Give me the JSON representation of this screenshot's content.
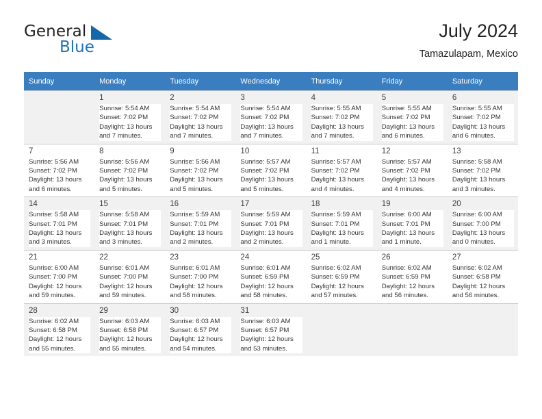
{
  "brand": {
    "name_part1": "General",
    "name_part2": "Blue",
    "triangle_icon": "blue-triangle-logo-icon",
    "accent_color": "#1566ab"
  },
  "header": {
    "title": "July 2024",
    "subtitle": "Tamazulapam, Mexico"
  },
  "theme": {
    "header_row_bg": "#3a7ebf",
    "header_row_text": "#ffffff",
    "alt_row_bg": "#f1f1f1",
    "cell_bg": "#ffffff",
    "grid_line": "#c8c8c8"
  },
  "calendar": {
    "weekday_headers": [
      "Sunday",
      "Monday",
      "Tuesday",
      "Wednesday",
      "Thursday",
      "Friday",
      "Saturday"
    ],
    "weeks": [
      {
        "band": "grey",
        "days": [
          {
            "num": "",
            "sunrise": "",
            "sunset": "",
            "daylight_hours": "",
            "daylight_minutes": ""
          },
          {
            "num": "1",
            "sunrise": "Sunrise: 5:54 AM",
            "sunset": "Sunset: 7:02 PM",
            "daylight_hours": "Daylight: 13 hours",
            "daylight_minutes": "and 7 minutes."
          },
          {
            "num": "2",
            "sunrise": "Sunrise: 5:54 AM",
            "sunset": "Sunset: 7:02 PM",
            "daylight_hours": "Daylight: 13 hours",
            "daylight_minutes": "and 7 minutes."
          },
          {
            "num": "3",
            "sunrise": "Sunrise: 5:54 AM",
            "sunset": "Sunset: 7:02 PM",
            "daylight_hours": "Daylight: 13 hours",
            "daylight_minutes": "and 7 minutes."
          },
          {
            "num": "4",
            "sunrise": "Sunrise: 5:55 AM",
            "sunset": "Sunset: 7:02 PM",
            "daylight_hours": "Daylight: 13 hours",
            "daylight_minutes": "and 7 minutes."
          },
          {
            "num": "5",
            "sunrise": "Sunrise: 5:55 AM",
            "sunset": "Sunset: 7:02 PM",
            "daylight_hours": "Daylight: 13 hours",
            "daylight_minutes": "and 6 minutes."
          },
          {
            "num": "6",
            "sunrise": "Sunrise: 5:55 AM",
            "sunset": "Sunset: 7:02 PM",
            "daylight_hours": "Daylight: 13 hours",
            "daylight_minutes": "and 6 minutes."
          }
        ]
      },
      {
        "band": "white",
        "days": [
          {
            "num": "7",
            "sunrise": "Sunrise: 5:56 AM",
            "sunset": "Sunset: 7:02 PM",
            "daylight_hours": "Daylight: 13 hours",
            "daylight_minutes": "and 6 minutes."
          },
          {
            "num": "8",
            "sunrise": "Sunrise: 5:56 AM",
            "sunset": "Sunset: 7:02 PM",
            "daylight_hours": "Daylight: 13 hours",
            "daylight_minutes": "and 5 minutes."
          },
          {
            "num": "9",
            "sunrise": "Sunrise: 5:56 AM",
            "sunset": "Sunset: 7:02 PM",
            "daylight_hours": "Daylight: 13 hours",
            "daylight_minutes": "and 5 minutes."
          },
          {
            "num": "10",
            "sunrise": "Sunrise: 5:57 AM",
            "sunset": "Sunset: 7:02 PM",
            "daylight_hours": "Daylight: 13 hours",
            "daylight_minutes": "and 5 minutes."
          },
          {
            "num": "11",
            "sunrise": "Sunrise: 5:57 AM",
            "sunset": "Sunset: 7:02 PM",
            "daylight_hours": "Daylight: 13 hours",
            "daylight_minutes": "and 4 minutes."
          },
          {
            "num": "12",
            "sunrise": "Sunrise: 5:57 AM",
            "sunset": "Sunset: 7:02 PM",
            "daylight_hours": "Daylight: 13 hours",
            "daylight_minutes": "and 4 minutes."
          },
          {
            "num": "13",
            "sunrise": "Sunrise: 5:58 AM",
            "sunset": "Sunset: 7:02 PM",
            "daylight_hours": "Daylight: 13 hours",
            "daylight_minutes": "and 3 minutes."
          }
        ]
      },
      {
        "band": "grey",
        "days": [
          {
            "num": "14",
            "sunrise": "Sunrise: 5:58 AM",
            "sunset": "Sunset: 7:01 PM",
            "daylight_hours": "Daylight: 13 hours",
            "daylight_minutes": "and 3 minutes."
          },
          {
            "num": "15",
            "sunrise": "Sunrise: 5:58 AM",
            "sunset": "Sunset: 7:01 PM",
            "daylight_hours": "Daylight: 13 hours",
            "daylight_minutes": "and 3 minutes."
          },
          {
            "num": "16",
            "sunrise": "Sunrise: 5:59 AM",
            "sunset": "Sunset: 7:01 PM",
            "daylight_hours": "Daylight: 13 hours",
            "daylight_minutes": "and 2 minutes."
          },
          {
            "num": "17",
            "sunrise": "Sunrise: 5:59 AM",
            "sunset": "Sunset: 7:01 PM",
            "daylight_hours": "Daylight: 13 hours",
            "daylight_minutes": "and 2 minutes."
          },
          {
            "num": "18",
            "sunrise": "Sunrise: 5:59 AM",
            "sunset": "Sunset: 7:01 PM",
            "daylight_hours": "Daylight: 13 hours",
            "daylight_minutes": "and 1 minute."
          },
          {
            "num": "19",
            "sunrise": "Sunrise: 6:00 AM",
            "sunset": "Sunset: 7:01 PM",
            "daylight_hours": "Daylight: 13 hours",
            "daylight_minutes": "and 1 minute."
          },
          {
            "num": "20",
            "sunrise": "Sunrise: 6:00 AM",
            "sunset": "Sunset: 7:00 PM",
            "daylight_hours": "Daylight: 13 hours",
            "daylight_minutes": "and 0 minutes."
          }
        ]
      },
      {
        "band": "white",
        "days": [
          {
            "num": "21",
            "sunrise": "Sunrise: 6:00 AM",
            "sunset": "Sunset: 7:00 PM",
            "daylight_hours": "Daylight: 12 hours",
            "daylight_minutes": "and 59 minutes."
          },
          {
            "num": "22",
            "sunrise": "Sunrise: 6:01 AM",
            "sunset": "Sunset: 7:00 PM",
            "daylight_hours": "Daylight: 12 hours",
            "daylight_minutes": "and 59 minutes."
          },
          {
            "num": "23",
            "sunrise": "Sunrise: 6:01 AM",
            "sunset": "Sunset: 7:00 PM",
            "daylight_hours": "Daylight: 12 hours",
            "daylight_minutes": "and 58 minutes."
          },
          {
            "num": "24",
            "sunrise": "Sunrise: 6:01 AM",
            "sunset": "Sunset: 6:59 PM",
            "daylight_hours": "Daylight: 12 hours",
            "daylight_minutes": "and 58 minutes."
          },
          {
            "num": "25",
            "sunrise": "Sunrise: 6:02 AM",
            "sunset": "Sunset: 6:59 PM",
            "daylight_hours": "Daylight: 12 hours",
            "daylight_minutes": "and 57 minutes."
          },
          {
            "num": "26",
            "sunrise": "Sunrise: 6:02 AM",
            "sunset": "Sunset: 6:59 PM",
            "daylight_hours": "Daylight: 12 hours",
            "daylight_minutes": "and 56 minutes."
          },
          {
            "num": "27",
            "sunrise": "Sunrise: 6:02 AM",
            "sunset": "Sunset: 6:58 PM",
            "daylight_hours": "Daylight: 12 hours",
            "daylight_minutes": "and 56 minutes."
          }
        ]
      },
      {
        "band": "grey",
        "days": [
          {
            "num": "28",
            "sunrise": "Sunrise: 6:02 AM",
            "sunset": "Sunset: 6:58 PM",
            "daylight_hours": "Daylight: 12 hours",
            "daylight_minutes": "and 55 minutes."
          },
          {
            "num": "29",
            "sunrise": "Sunrise: 6:03 AM",
            "sunset": "Sunset: 6:58 PM",
            "daylight_hours": "Daylight: 12 hours",
            "daylight_minutes": "and 55 minutes."
          },
          {
            "num": "30",
            "sunrise": "Sunrise: 6:03 AM",
            "sunset": "Sunset: 6:57 PM",
            "daylight_hours": "Daylight: 12 hours",
            "daylight_minutes": "and 54 minutes."
          },
          {
            "num": "31",
            "sunrise": "Sunrise: 6:03 AM",
            "sunset": "Sunset: 6:57 PM",
            "daylight_hours": "Daylight: 12 hours",
            "daylight_minutes": "and 53 minutes."
          },
          {
            "num": "",
            "sunrise": "",
            "sunset": "",
            "daylight_hours": "",
            "daylight_minutes": ""
          },
          {
            "num": "",
            "sunrise": "",
            "sunset": "",
            "daylight_hours": "",
            "daylight_minutes": ""
          },
          {
            "num": "",
            "sunrise": "",
            "sunset": "",
            "daylight_hours": "",
            "daylight_minutes": ""
          }
        ]
      }
    ]
  }
}
